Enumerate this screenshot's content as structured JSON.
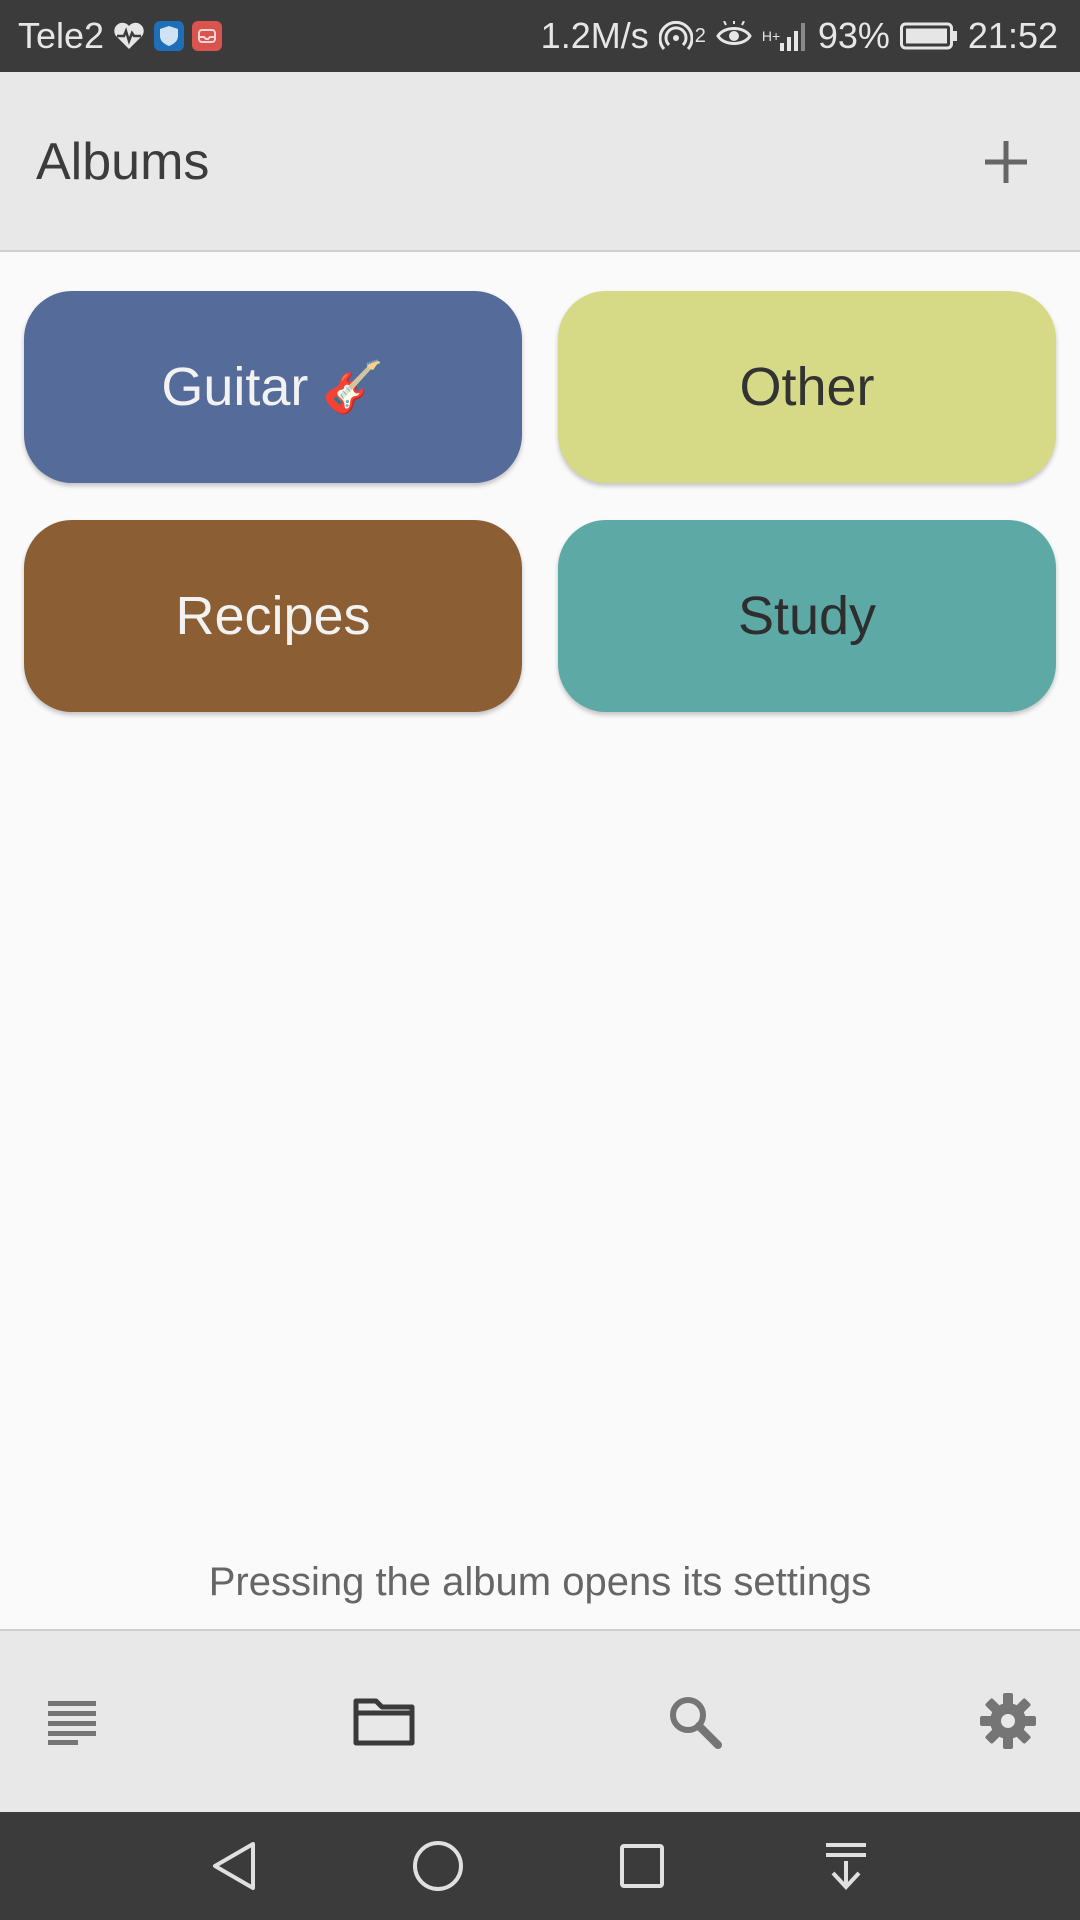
{
  "status_bar": {
    "carrier": "Tele2",
    "speed": "1.2M/s",
    "hotspot_count": "2",
    "network": "H+",
    "battery": "93%",
    "time": "21:52",
    "icons": [
      "heart-pulse-icon",
      "shield-app-icon",
      "mail-app-icon",
      "hotspot-icon",
      "eye-icon",
      "signal-icon",
      "battery-icon"
    ]
  },
  "app_bar": {
    "title": "Albums",
    "add_icon": "plus-icon"
  },
  "albums": [
    {
      "label": "Guitar",
      "emoji": "🎸",
      "color": "#556c9b",
      "text_color": "#f2f2f2"
    },
    {
      "label": "Other",
      "color": "#d6da86",
      "text_color": "#333333"
    },
    {
      "label": "Recipes",
      "color": "#8b5e34",
      "text_color": "#f2f2f2"
    },
    {
      "label": "Study",
      "color": "#5ca9a6",
      "text_color": "#2e2e2e"
    }
  ],
  "hint": "Pressing the album opens its settings",
  "bottom_nav": {
    "items": [
      "notes-list-icon",
      "folder-icon",
      "search-icon",
      "settings-gear-icon"
    ],
    "active": "folder-icon"
  },
  "system_nav": {
    "items": [
      "back-icon",
      "home-icon",
      "recents-icon",
      "notification-pull-icon"
    ]
  }
}
